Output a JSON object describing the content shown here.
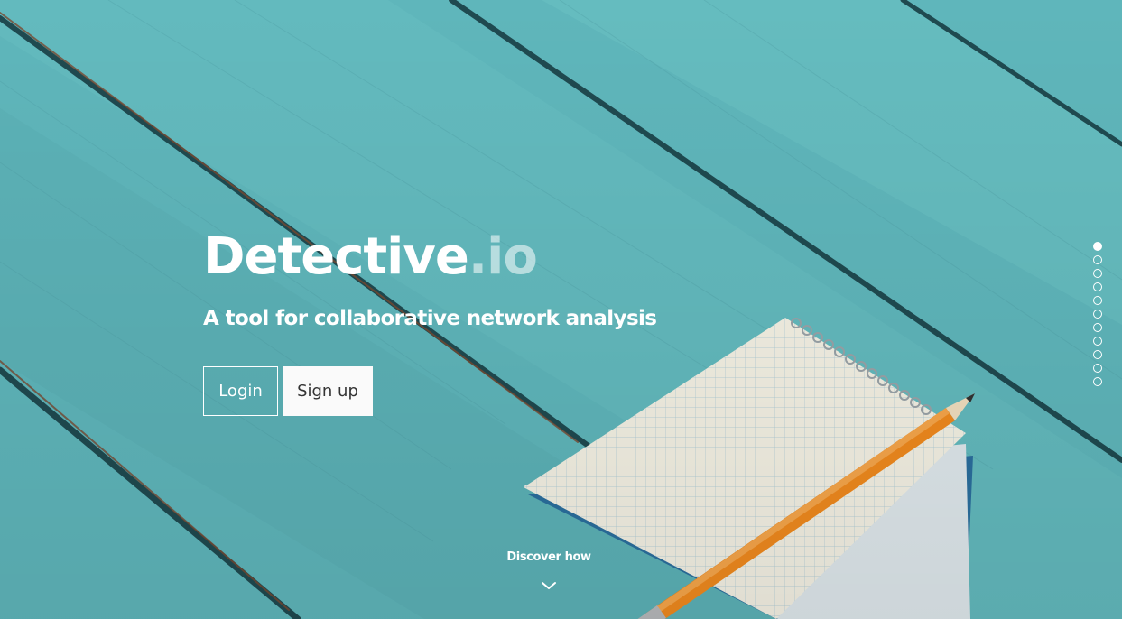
{
  "brand": {
    "name": "Detective",
    "tld": ".io"
  },
  "hero": {
    "tagline": "A tool for collaborative network analysis"
  },
  "actions": {
    "login_label": "Login",
    "signup_label": "Sign up"
  },
  "discover": {
    "label": "Discover how",
    "icon": "chevron-down-icon"
  },
  "section_nav": {
    "count": 11,
    "active_index": 0
  },
  "colors": {
    "background": "#5fb6bb",
    "text": "#ffffff",
    "signup_bg": "#fafafa"
  }
}
